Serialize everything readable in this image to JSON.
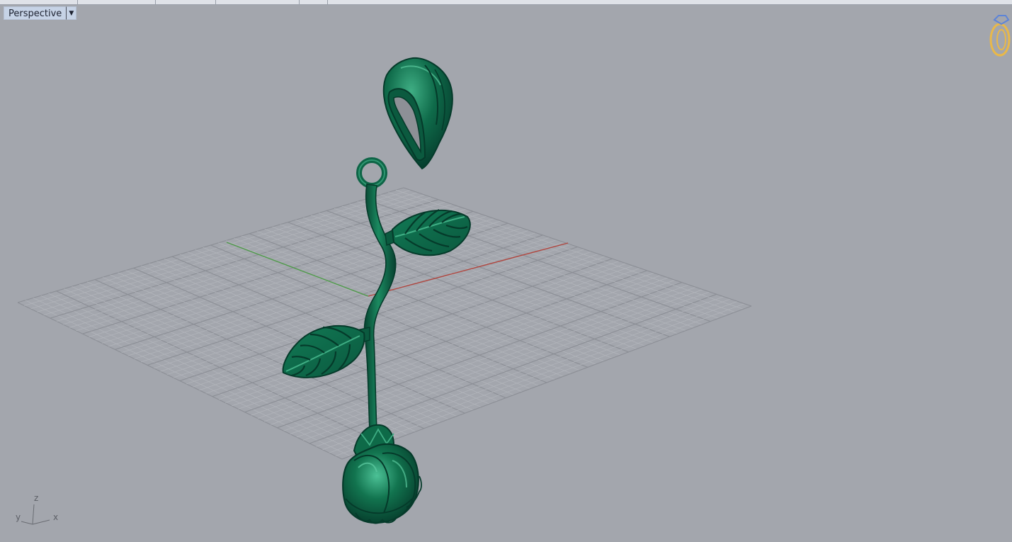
{
  "viewport": {
    "title": "Perspective",
    "menu_icon": "triangle-down-icon"
  },
  "axis_widget": {
    "z": "z",
    "y": "y",
    "x": "x"
  },
  "icons": {
    "ring_logo": "ring-logo-icon"
  },
  "colors": {
    "background": "#a3a6ad",
    "grid_minor": "#b3b6bc",
    "grid_major": "#8b8e95",
    "x_axis": "#b0463f",
    "y_axis": "#4f9a4a",
    "model": "#0f6b4a",
    "model_highlight": "#3fae84",
    "model_shadow": "#074331",
    "header_bg": "#c6d3e6",
    "logo_gold": "#e8b84a",
    "logo_gem": "#5d84d8"
  }
}
